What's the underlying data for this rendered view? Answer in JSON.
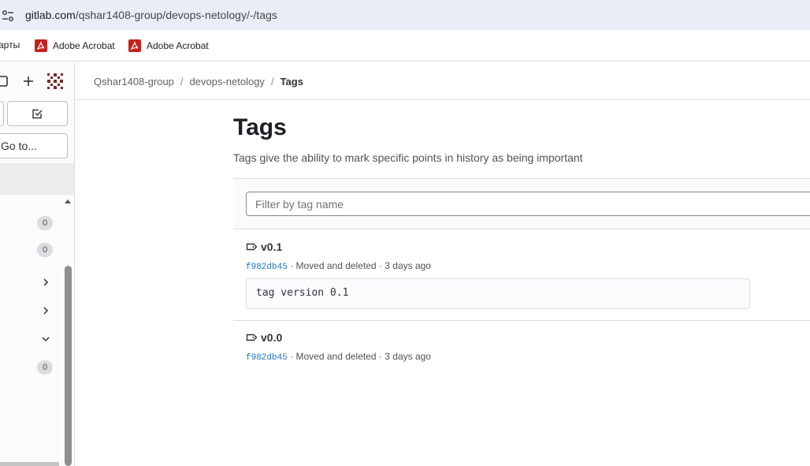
{
  "browser": {
    "url_host": "gitlab.com",
    "url_path": "/qshar1408-group/devops-netology/-/tags"
  },
  "bookmarks": [
    {
      "label": "Карты"
    },
    {
      "label": "Adobe Acrobat"
    },
    {
      "label": "Adobe Acrobat"
    }
  ],
  "sidebar": {
    "goto_label": "Go to...",
    "badges": [
      "0",
      "0",
      "0"
    ]
  },
  "breadcrumbs": {
    "group": "Qshar1408-group",
    "project": "devops-netology",
    "current": "Tags"
  },
  "page": {
    "title": "Tags",
    "description": "Tags give the ability to mark specific points in history as being important"
  },
  "filter": {
    "placeholder": "Filter by tag name"
  },
  "tags": [
    {
      "name": "v0.1",
      "sha": "f982db45",
      "commit_title": "Moved and deleted",
      "time_ago": "3 days ago",
      "message": "tag version 0.1"
    },
    {
      "name": "v0.0",
      "sha": "f982db45",
      "commit_title": "Moved and deleted",
      "time_ago": "3 days ago"
    }
  ],
  "colors": {
    "link": "#1f75cb",
    "pdf_red": "#c5221f",
    "addrbar_bg": "#e9edf6"
  }
}
